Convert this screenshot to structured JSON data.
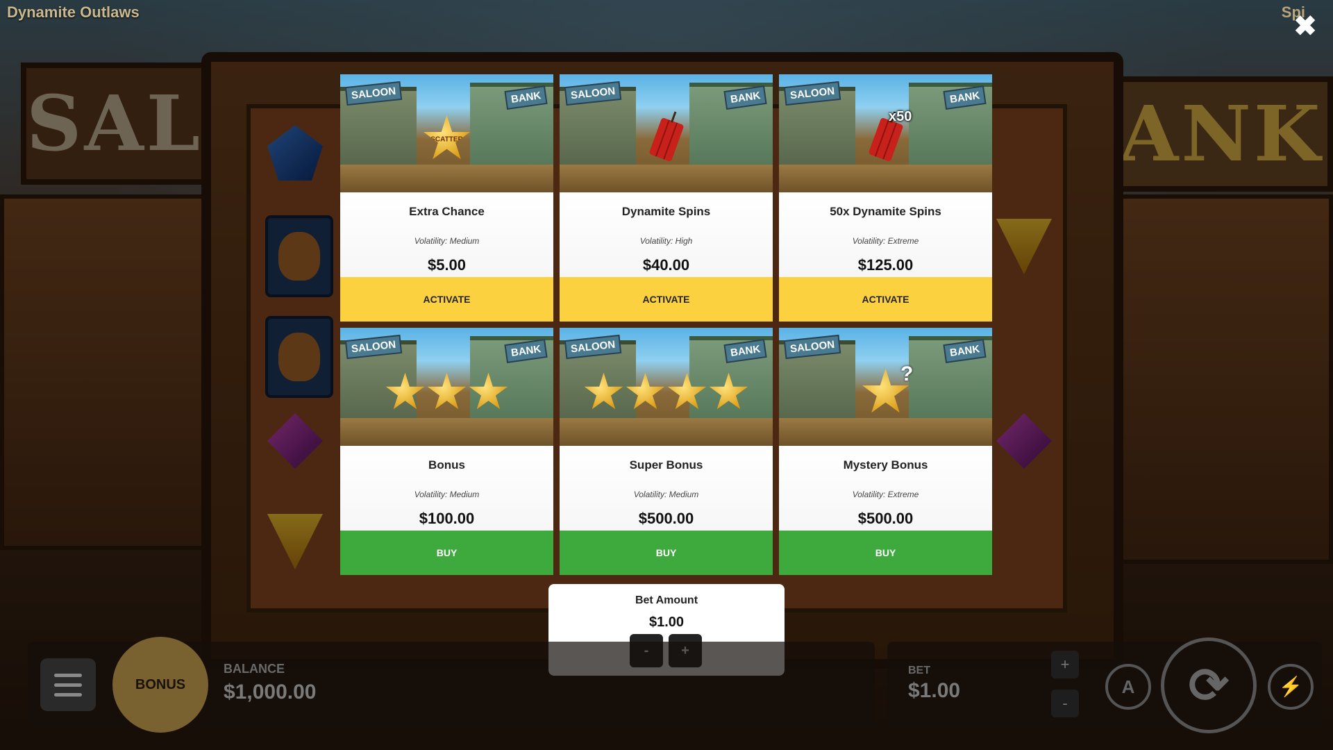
{
  "game": {
    "title": "Dynamite Outlaws",
    "title_right": "Spi"
  },
  "background": {
    "saloon_sign": "SALO",
    "bank_sign": "ANK"
  },
  "close": {
    "icon": "close-icon",
    "glyph": "✖"
  },
  "cards": [
    {
      "title": "Extra Chance",
      "volatility": "Volatility: Medium",
      "price": "$5.00",
      "button": "ACTIVATE",
      "image": "scatter-sheriff-star",
      "badge_text": "SCATTER",
      "count": 1
    },
    {
      "title": "Dynamite Spins",
      "volatility": "Volatility: High",
      "price": "$40.00",
      "button": "ACTIVATE",
      "image": "dynamite"
    },
    {
      "title": "50x Dynamite Spins",
      "volatility": "Volatility: Extreme",
      "price": "$125.00",
      "button": "ACTIVATE",
      "image": "dynamite-x50",
      "multiplier": "x50"
    },
    {
      "title": "Bonus",
      "volatility": "Volatility: Medium",
      "price": "$100.00",
      "button": "BUY",
      "image": "three-scatter-stars",
      "count": 3
    },
    {
      "title": "Super Bonus",
      "volatility": "Volatility: Medium",
      "price": "$500.00",
      "button": "BUY",
      "image": "four-scatter-stars",
      "count": 4
    },
    {
      "title": "Mystery Bonus",
      "volatility": "Volatility: Extreme",
      "price": "$500.00",
      "button": "BUY",
      "image": "mystery-scatter-star",
      "mystery": "?"
    }
  ],
  "image_scene": {
    "sign_left": "SALOON",
    "sign_right": "BANK"
  },
  "bet_panel": {
    "title": "Bet Amount",
    "value": "$1.00",
    "minus": "-",
    "plus": "+"
  },
  "hud": {
    "bonus_label": "BONUS",
    "balance_label": "BALANCE",
    "balance_value": "$1,000.00",
    "bet_label": "BET",
    "bet_value": "$1.00",
    "step_plus": "+",
    "step_minus": "-",
    "auto_glyph": "A",
    "spin_glyph": "⟳",
    "turbo_glyph": "⚡"
  },
  "colors": {
    "activate": "#fbd140",
    "buy": "#3eaa3e",
    "bonus_circle": "#7a6230"
  }
}
